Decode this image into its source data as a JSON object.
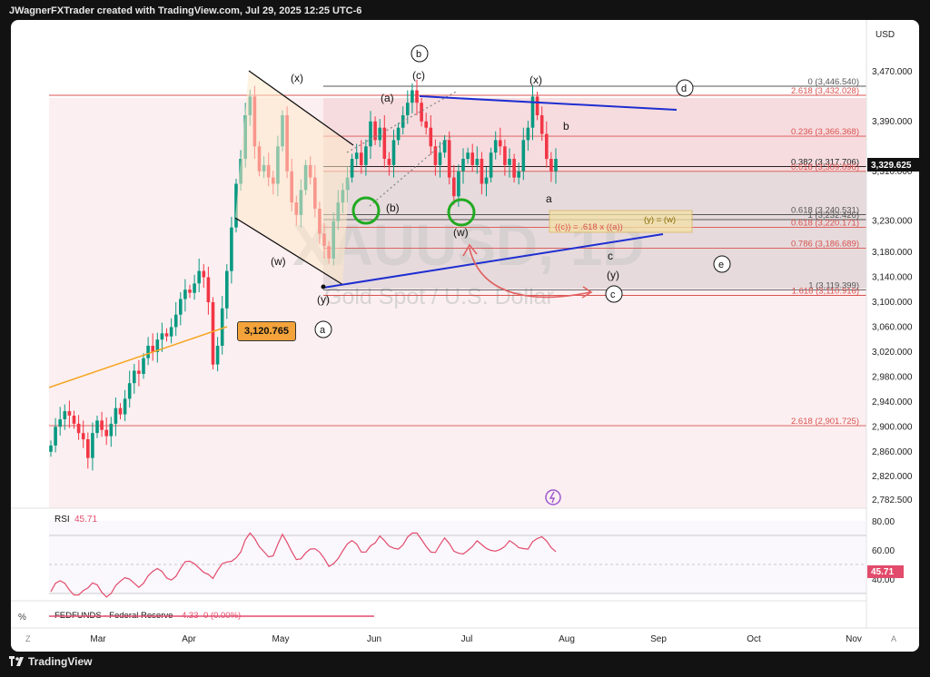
{
  "header": {
    "text": "JWagnerFXTrader created with TradingView.com, Jul 29, 2025 12:25 UTC-6"
  },
  "footer": {
    "brand": "TradingView"
  },
  "chart": {
    "currency": "USD",
    "watermark_symbol": "XAUUSD, 1D",
    "watermark_desc": "Gold Spot / U.S. Dollar",
    "last_price": "3,329.625",
    "price_callout": "3,120.765"
  },
  "chart_data": {
    "type": "candlestick",
    "symbol": "XAUUSD",
    "timeframe": "1D",
    "x_labels": [
      "Mar",
      "Apr",
      "May",
      "Jun",
      "Jul",
      "Aug",
      "Sep",
      "Oct",
      "Nov"
    ],
    "y_ticks": [
      "3,470.000",
      "3,390.000",
      "3,310.000",
      "3,230.000",
      "3,180.000",
      "3,140.000",
      "3,100.000",
      "3,060.000",
      "3,020.000",
      "2,980.000",
      "2,940.000",
      "2,900.000",
      "2,860.000",
      "2,820.000",
      "2,782.500"
    ],
    "ohlc_closes": [
      2870,
      2900,
      2912,
      2925,
      2918,
      2905,
      2890,
      2880,
      2850,
      2890,
      2910,
      2895,
      2885,
      2905,
      2930,
      2920,
      2945,
      2970,
      2990,
      2985,
      3010,
      3030,
      3020,
      3040,
      3050,
      3045,
      3060,
      3080,
      3105,
      3120,
      3115,
      3130,
      3150,
      3140,
      3100,
      3000,
      3030,
      3090,
      3150,
      3220,
      3290,
      3330,
      3400,
      3430,
      3350,
      3310,
      3320,
      3300,
      3290,
      3350,
      3400,
      3310,
      3260,
      3240,
      3280,
      3320,
      3300,
      3250,
      3210,
      3190,
      3170,
      3230,
      3260,
      3280,
      3300,
      3330,
      3340,
      3320,
      3350,
      3390,
      3360,
      3380,
      3330,
      3320,
      3360,
      3380,
      3400,
      3420,
      3440,
      3420,
      3390,
      3380,
      3350,
      3320,
      3340,
      3360,
      3300,
      3270,
      3310,
      3330,
      3340,
      3320,
      3330,
      3290,
      3300,
      3340,
      3360,
      3350,
      3320,
      3330,
      3300,
      3310,
      3360,
      3380,
      3430,
      3400,
      3370,
      3330,
      3310,
      3330
    ],
    "fib_levels": [
      {
        "label": "0 (3,446.540)",
        "value": 3446.54,
        "color": "#555555"
      },
      {
        "label": "2.618 (3,432.028)",
        "value": 3432.028,
        "color": "#d9534f"
      },
      {
        "label": "0.236 (3,366.368)",
        "value": 3366.368,
        "color": "#d9534f"
      },
      {
        "label": "0.382 (3,317.706)",
        "value": 3317.706,
        "color": "#222222"
      },
      {
        "label": "0.618 (3,309.896)",
        "value": 3309.896,
        "color": "#d9534f"
      },
      {
        "label": "0.618 (3,240.531)",
        "value": 3240.531,
        "color": "#555555"
      },
      {
        "label": "1 (3,232.426)",
        "value": 3232.426,
        "color": "#555555"
      },
      {
        "label": "0.618 (3,220.171)",
        "value": 3220.171,
        "color": "#d9534f"
      },
      {
        "label": "0.786 (3,186.689)",
        "value": 3186.689,
        "color": "#d9534f"
      },
      {
        "label": "1 (3,119.399)",
        "value": 3119.399,
        "color": "#555555"
      },
      {
        "label": "1.618 (3,110.916)",
        "value": 3110.916,
        "color": "#d9534f"
      },
      {
        "label": "2.618 (2,901.725)",
        "value": 2901.725,
        "color": "#d9534f"
      }
    ],
    "wave_labels": [
      "(x)",
      "(w)",
      "(y)",
      "(a)",
      "(b)",
      "(c)",
      "(w)",
      "(x)",
      "b",
      "a",
      "c",
      "(y)"
    ],
    "circled_labels": [
      "a",
      "b",
      "c",
      "d",
      "e"
    ],
    "annotations": [
      "((c)) = .618 x ((a))",
      "(y) = (w)"
    ],
    "rsi": {
      "label": "RSI",
      "value": "45.71",
      "ticks": [
        "80.00",
        "60.00",
        "40.00"
      ],
      "value_badge": "45.71"
    },
    "fedfunds": {
      "label": "FEDFUNDS · Federal Reserve",
      "value": "4.33",
      "change": "0 (0.00%)"
    },
    "colors": {
      "up": "#089981",
      "down": "#f23645",
      "triangle": "#1f2ed1",
      "fib_red": "#d9534f",
      "trend": "#f5a623",
      "circle": "#22aa22"
    }
  },
  "axis_labels": {
    "percent": "%",
    "auto": "A",
    "zoom": "Z"
  }
}
